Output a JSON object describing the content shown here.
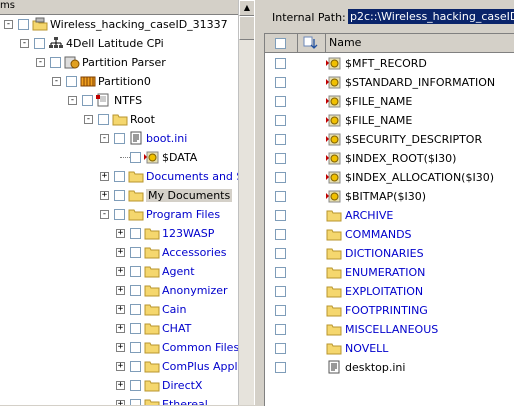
{
  "left_header": "ms",
  "tree": [
    {
      "label": "Wireless_hacking_caseID_31337",
      "icon": "case-icon",
      "blue": false
    },
    {
      "label": "4Dell Latitude CPi",
      "icon": "network-icon",
      "blue": false
    },
    {
      "label": "Partition Parser",
      "icon": "parser-icon",
      "blue": false
    },
    {
      "label": "Partition0",
      "icon": "partition-icon",
      "blue": false
    },
    {
      "label": "NTFS",
      "icon": "ntfs-icon",
      "blue": false
    },
    {
      "label": "Root",
      "icon": "folder-icon",
      "blue": false
    },
    {
      "label": "boot.ini",
      "icon": "file-icon",
      "blue": true
    },
    {
      "label": "$DATA",
      "icon": "stream-icon",
      "blue": false
    },
    {
      "label": "Documents and Setti",
      "icon": "folder-icon",
      "blue": true
    },
    {
      "label": "My Documents",
      "icon": "folder-icon",
      "blue": false,
      "selected": true
    },
    {
      "label": "Program Files",
      "icon": "folder-icon",
      "blue": true
    },
    {
      "label": "123WASP",
      "icon": "folder-icon",
      "blue": true
    },
    {
      "label": "Accessories",
      "icon": "folder-icon",
      "blue": true
    },
    {
      "label": "Agent",
      "icon": "folder-icon",
      "blue": true
    },
    {
      "label": "Anonymizer",
      "icon": "folder-icon",
      "blue": true
    },
    {
      "label": "Cain",
      "icon": "folder-icon",
      "blue": true
    },
    {
      "label": "CHAT",
      "icon": "folder-icon",
      "blue": true
    },
    {
      "label": "Common Files",
      "icon": "folder-icon",
      "blue": true
    },
    {
      "label": "ComPlus Applicatio",
      "icon": "folder-icon",
      "blue": true
    },
    {
      "label": "DirectX",
      "icon": "folder-icon",
      "blue": true
    },
    {
      "label": "Ethereal",
      "icon": "folder-icon",
      "blue": true
    }
  ],
  "internal_path_label": "Internal Path:",
  "internal_path_value": "p2c::\\Wireless_hacking_caseID_31",
  "column_name": "Name",
  "rows": [
    {
      "name": "$MFT_RECORD",
      "kind": "stream"
    },
    {
      "name": "$STANDARD_INFORMATION",
      "kind": "stream"
    },
    {
      "name": "$FILE_NAME",
      "kind": "stream"
    },
    {
      "name": "$FILE_NAME",
      "kind": "stream"
    },
    {
      "name": "$SECURITY_DESCRIPTOR",
      "kind": "stream"
    },
    {
      "name": "$INDEX_ROOT($I30)",
      "kind": "stream"
    },
    {
      "name": "$INDEX_ALLOCATION($I30)",
      "kind": "stream"
    },
    {
      "name": "$BITMAP($I30)",
      "kind": "stream"
    },
    {
      "name": "ARCHIVE",
      "kind": "folder"
    },
    {
      "name": "COMMANDS",
      "kind": "folder"
    },
    {
      "name": "DICTIONARIES",
      "kind": "folder"
    },
    {
      "name": "ENUMERATION",
      "kind": "folder"
    },
    {
      "name": "EXPLOITATION",
      "kind": "folder"
    },
    {
      "name": "FOOTPRINTING",
      "kind": "folder"
    },
    {
      "name": "MISCELLANEOUS",
      "kind": "folder"
    },
    {
      "name": "NOVELL",
      "kind": "folder"
    },
    {
      "name": "desktop.ini",
      "kind": "file"
    }
  ],
  "colors": {
    "selection": "#0a246a",
    "link": "#0000cc",
    "folder": "#f5d76e"
  }
}
